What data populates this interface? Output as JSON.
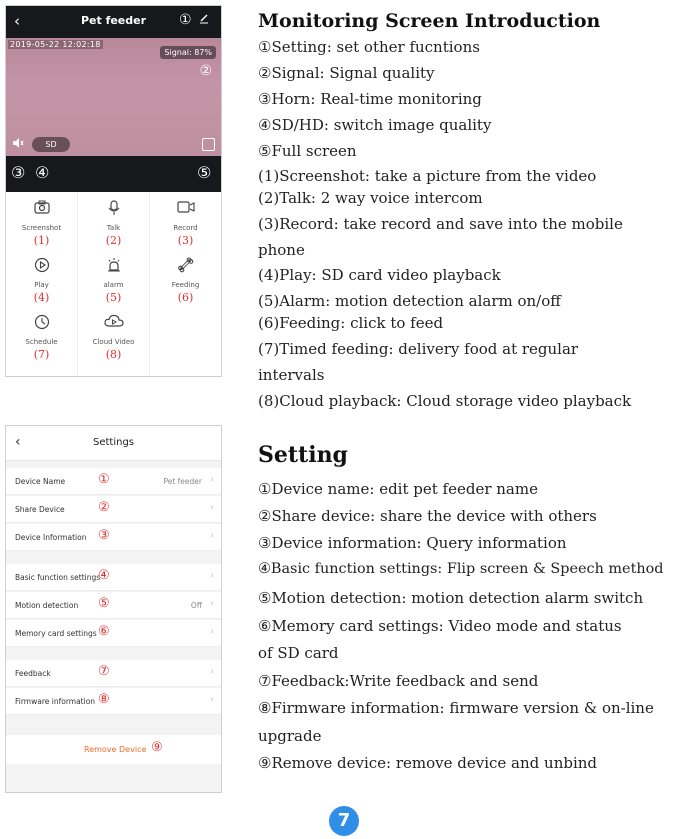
{
  "monitor_phone": {
    "title": "Pet feeder",
    "back_icon": "‹",
    "marker_1": "①",
    "timestamp": "2019-05-22 12:02:18",
    "signal": "Signal: 87%",
    "marker_2": "②",
    "sd_label": "SD",
    "bar_markers": [
      "③",
      "④",
      "⑤"
    ],
    "functions": [
      {
        "label": "Screenshot",
        "num": "(1)",
        "icon": "camera-icon"
      },
      {
        "label": "Talk",
        "num": "(2)",
        "icon": "microphone-icon"
      },
      {
        "label": "Record",
        "num": "(3)",
        "icon": "video-record-icon"
      },
      {
        "label": "Play",
        "num": "(4)",
        "icon": "play-icon"
      },
      {
        "label": "alarm",
        "num": "(5)",
        "icon": "alarm-icon"
      },
      {
        "label": "Feeding",
        "num": "(6)",
        "icon": "bone-icon"
      },
      {
        "label": "Schedule",
        "num": "(7)",
        "icon": "clock-icon"
      },
      {
        "label": "Cloud Video",
        "num": "(8)",
        "icon": "cloud-play-icon"
      }
    ]
  },
  "monitor_text": {
    "title": "Monitoring Screen Introduction",
    "lines": [
      "①Setting: set other fucntions",
      "②Signal: Signal quality",
      "③Horn: Real-time monitoring",
      "④SD/HD: switch image quality",
      "⑤Full screen",
      "(1)Screenshot:  take a picture from the video",
      "(2)Talk: 2 way voice intercom",
      "(3)Record: take record and save into the mobile",
      "phone",
      "(4)Play: SD card video playback",
      "(5)Alarm:  motion detection alarm on/off",
      "(6)Feeding:  click to feed",
      "(7)Timed feeding:  delivery food at regular",
      "intervals",
      "(8)Cloud playback: Cloud storage video playback"
    ]
  },
  "settings_phone": {
    "title": "Settings",
    "back_icon": "‹",
    "rows": [
      {
        "label": "Device Name",
        "num": "①",
        "value": "Pet feeder"
      },
      {
        "label": "Share Device",
        "num": "②",
        "value": ""
      },
      {
        "label": "Device Information",
        "num": "③",
        "value": ""
      },
      {
        "label": "Basic function settings",
        "num": "④",
        "value": ""
      },
      {
        "label": "Motion detection",
        "num": "⑤",
        "value": "Off"
      },
      {
        "label": "Memory card settings",
        "num": "⑥",
        "value": ""
      },
      {
        "label": "Feedback",
        "num": "⑦",
        "value": ""
      },
      {
        "label": "Firmware information",
        "num": "⑧",
        "value": ""
      }
    ],
    "remove_label": "Remove Device",
    "remove_num": "⑨"
  },
  "settings_text": {
    "title": "Setting",
    "lines": [
      "①Device name: edit pet feeder name",
      "②Share device: share the device with others",
      "③Device information:  Query information",
      "④Basic function settings: Flip screen & Speech method",
      "⑤Motion detection: motion detection alarm switch",
      "⑥Memory card settings: Video mode and status",
      "of SD card",
      "⑦Feedback:Write feedback and send",
      "⑧Firmware information: firmware version  & on-line",
      "upgrade",
      "⑨Remove device: remove device and unbind"
    ]
  },
  "page_number": "7",
  "colors": {
    "accent_red": "#e03030",
    "remove_orange": "#f06a2a",
    "badge_blue": "#2f8fe6"
  }
}
